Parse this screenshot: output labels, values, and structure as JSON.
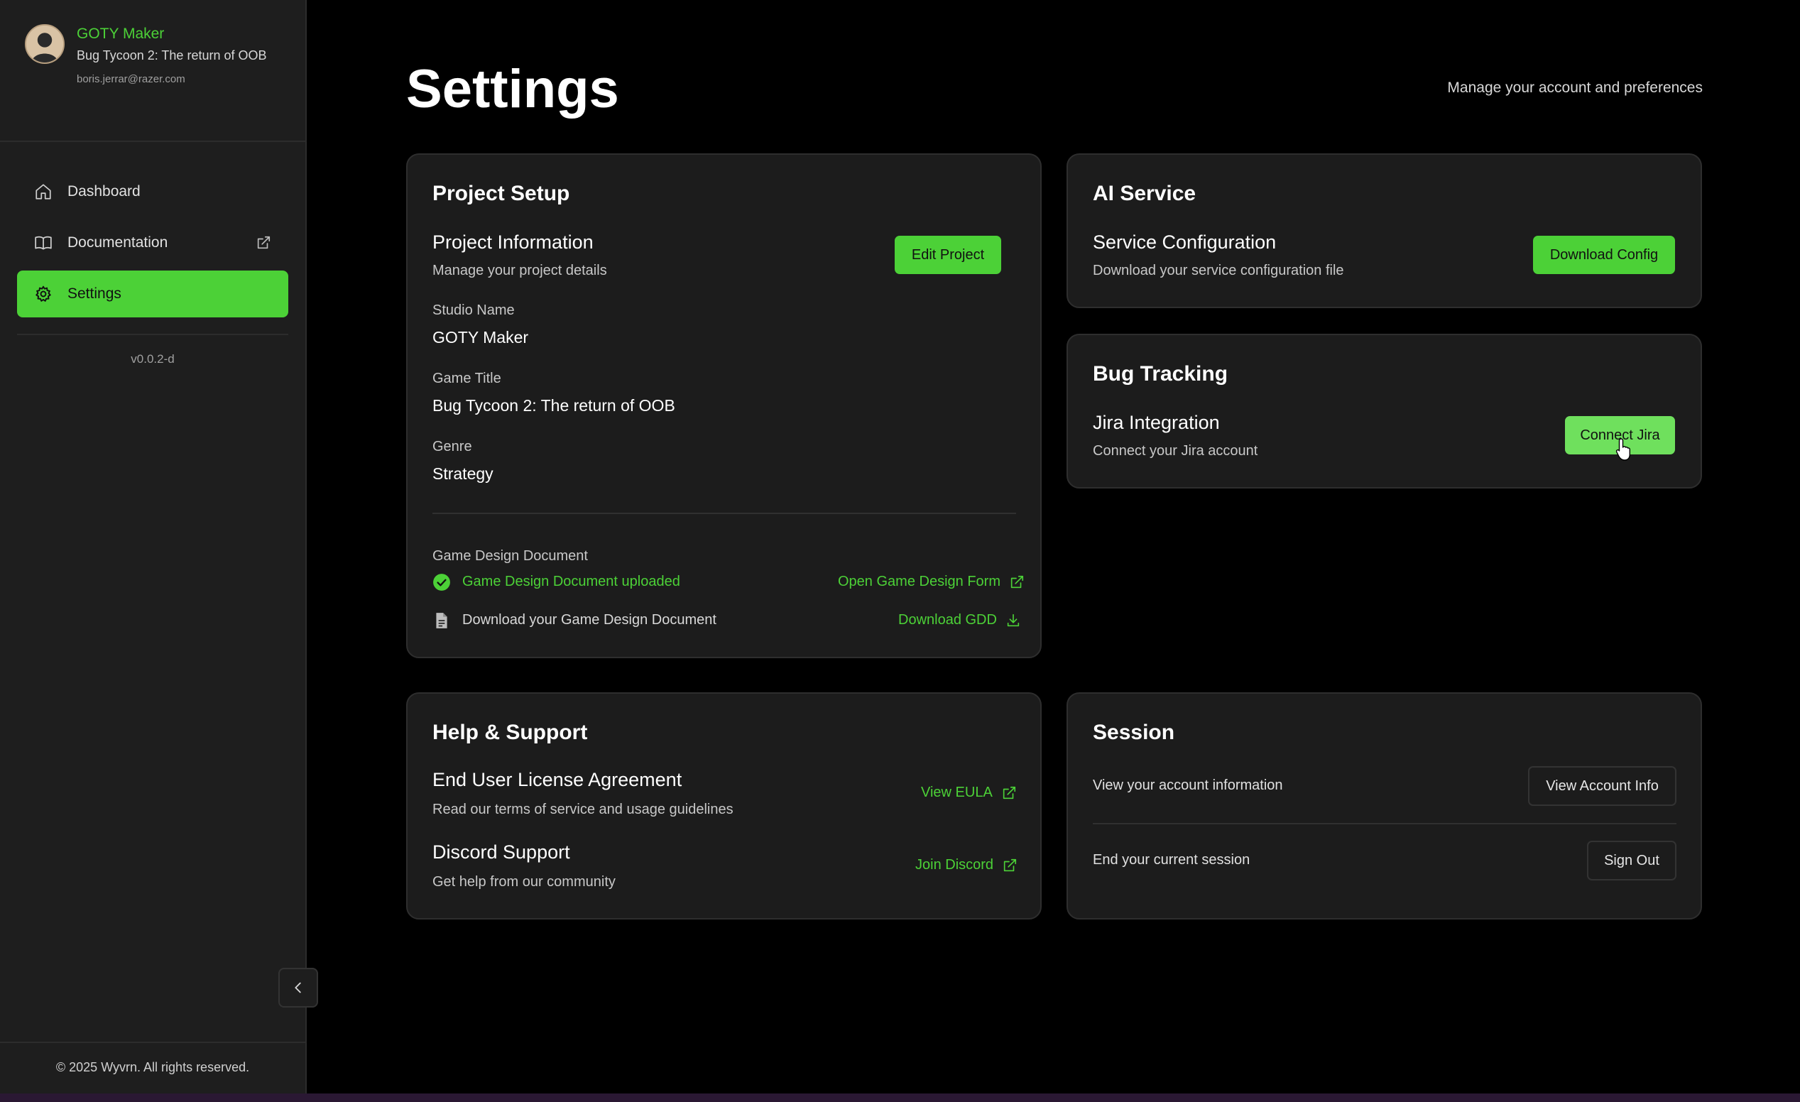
{
  "profile": {
    "studio_name": "GOTY Maker",
    "game_title": "Bug Tycoon 2: The return of OOB",
    "email": "boris.jerrar@razer.com"
  },
  "sidebar": {
    "items": [
      {
        "label": "Dashboard",
        "icon": "home-icon"
      },
      {
        "label": "Documentation",
        "icon": "book-icon",
        "external": true
      },
      {
        "label": "Settings",
        "icon": "gear-icon",
        "active": true
      }
    ],
    "version": "v0.0.2-d",
    "copyright": "© 2025 Wyvrn. All rights reserved."
  },
  "header": {
    "title": "Settings",
    "subtitle": "Manage your account and preferences"
  },
  "project_setup": {
    "title": "Project Setup",
    "info_title": "Project Information",
    "info_desc": "Manage your project details",
    "edit_label": "Edit Project",
    "studio_label": "Studio Name",
    "studio_value": "GOTY Maker",
    "game_label": "Game Title",
    "game_value": "Bug Tycoon 2: The return of OOB",
    "genre_label": "Genre",
    "genre_value": "Strategy",
    "gdd_label": "Game Design Document",
    "gdd_status": "Game Design Document uploaded",
    "gdd_form_link": "Open Game Design Form",
    "gdd_download_text": "Download your Game Design Document",
    "gdd_download_link": "Download GDD"
  },
  "ai_service": {
    "title": "AI Service",
    "config_title": "Service Configuration",
    "config_desc": "Download your service configuration file",
    "download_label": "Download Config"
  },
  "bug_tracking": {
    "title": "Bug Tracking",
    "jira_title": "Jira Integration",
    "jira_desc": "Connect your Jira account",
    "connect_label": "Connect Jira"
  },
  "help_support": {
    "title": "Help & Support",
    "eula_title": "End User License Agreement",
    "eula_desc": "Read our terms of service and usage guidelines",
    "eula_link": "View EULA",
    "discord_title": "Discord Support",
    "discord_desc": "Get help from our community",
    "discord_link": "Join Discord"
  },
  "session": {
    "title": "Session",
    "account_text": "View your account information",
    "account_button": "View Account Info",
    "signout_text": "End your current session",
    "signout_button": "Sign Out"
  },
  "colors": {
    "accent": "#4cd137",
    "background": "#000000",
    "sidebar": "#1e1e1e",
    "card": "#1c1c1c"
  }
}
